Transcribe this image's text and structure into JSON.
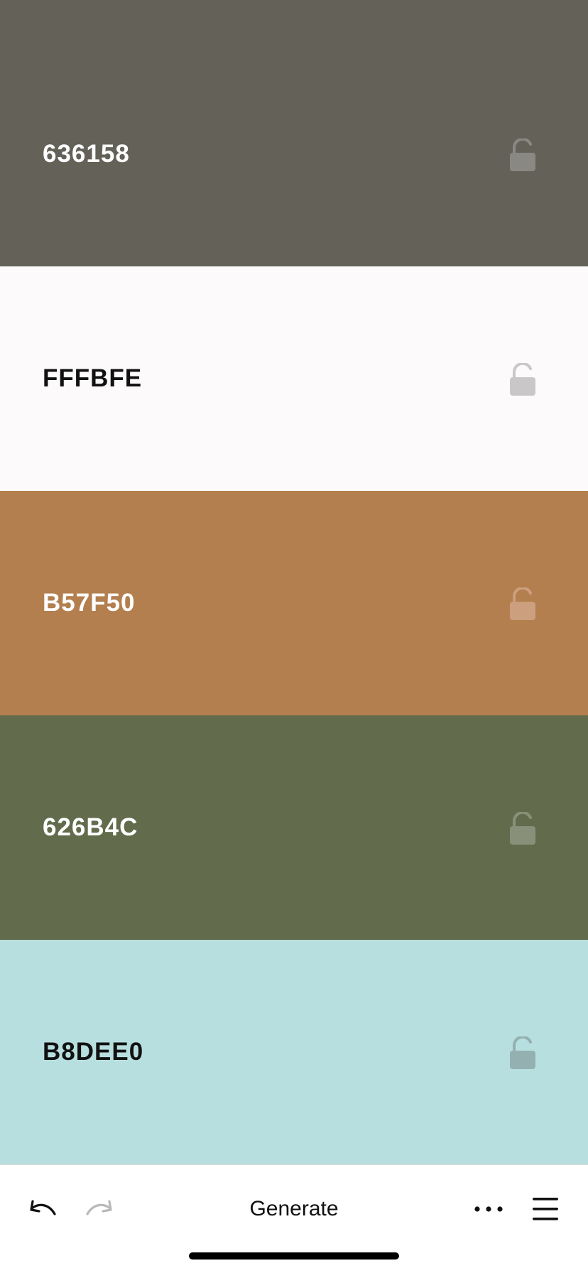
{
  "palette": {
    "swatches": [
      {
        "hex": "636158",
        "color": "#636158",
        "text_color": "#ffffff",
        "lock_color": "#8a8882",
        "locked": false
      },
      {
        "hex": "FFFBFE",
        "color": "#FCFAFB",
        "text_color": "#111111",
        "lock_color": "#c9c7c8",
        "locked": false
      },
      {
        "hex": "B57F50",
        "color": "#B37F4E",
        "text_color": "#ffffff",
        "lock_color": "#cc9f7e",
        "locked": false
      },
      {
        "hex": "626B4C",
        "color": "#626B4C",
        "text_color": "#ffffff",
        "lock_color": "#89907a",
        "locked": false
      },
      {
        "hex": "B8DEE0",
        "color": "#B8DFDF",
        "text_color": "#111111",
        "lock_color": "#94b0b1",
        "locked": false
      }
    ]
  },
  "toolbar": {
    "undo_icon": "undo-arrow-icon",
    "redo_icon": "redo-arrow-icon",
    "redo_enabled": false,
    "generate_label": "Generate",
    "more_icon": "ellipsis-icon",
    "menu_icon": "hamburger-menu-icon"
  }
}
